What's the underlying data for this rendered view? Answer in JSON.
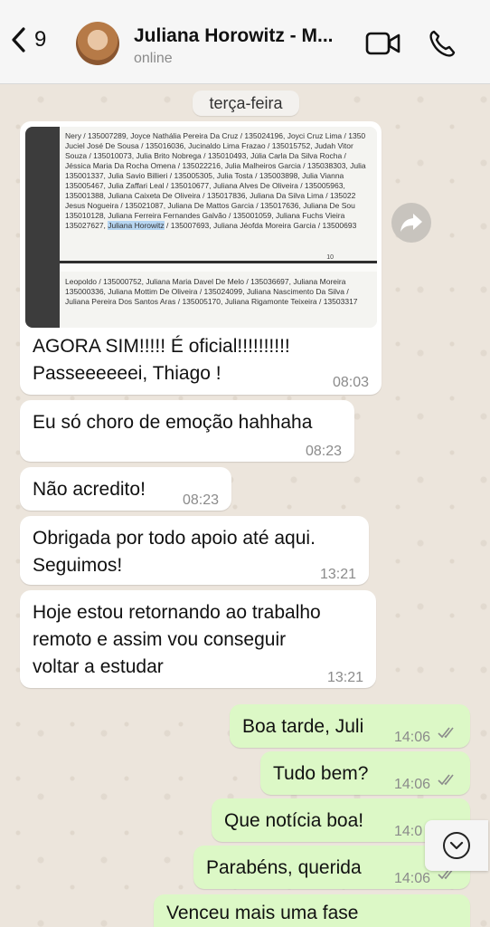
{
  "header": {
    "back_count": "9",
    "contact_name": "Juliana Horowitz - M...",
    "status": "online"
  },
  "date_chip": "terça-feira",
  "photo_lines": [
    "Nery / 135007289, Joyce Nathália Pereira Da Cruz / 135024196, Joyci Cruz Lima / 1350",
    "Juciel José De Sousa / 135016036, Jucinaldo Lima Frazao / 135015752, Judah Vitor",
    "Souza / 135010073, Julia Brito Nobrega / 135010493, Júlia Carla Da Silva Rocha /",
    "Jéssica Maria Da Rocha Omena / 135022216, Julia Malheiros Garcia / 135038303, Julia",
    "135001337, Julia Savio Billieri / 135005305, Julia Tosta / 135003898, Julia Vianna",
    "135005467, Julia Zaffari Leal / 135010677, Juliana Alves De Oliveira / 135005963,",
    "135001388, Juliana Caixeta De Oliveira / 135017836, Juliana Da Silva Lima / 135022",
    "Jesus Nogueira / 135021087, Juliana De Mattos Garcia / 135017636, Juliana De Sou",
    "135010128, Juliana Ferreira Fernandes Galvão / 135001059, Juliana Fuchs Vieira"
  ],
  "photo_highlight_line": {
    "before": "135027627, ",
    "highlight": "Juliana Horowitz",
    "after": " / 135007693, Juliana Jéofda Moreira Garcia / 13500693"
  },
  "photo_page_number": "10",
  "photo_lines_bottom": [
    "Leopoldo / 135000752, Juliana Maria Davel De Melo / 135036697, Juliana Moreira",
    "135000336, Juliana Mottim De Oliveira / 135024099, Juliana Nascimento Da Silva /",
    "Juliana Pereira Dos Santos Aras / 135005170, Juliana Rigamonte Teixeira / 13503317"
  ],
  "messages": [
    {
      "text": "AGORA SIM!!!!! É oficial!!!!!!!!!!\nPasseeeeeei, Thiago !",
      "time": "08:03"
    },
    {
      "text": "Eu só choro de emoção hahhaha",
      "time": "08:23"
    },
    {
      "text": "Não acredito!",
      "time": "08:23"
    },
    {
      "text": "Obrigada por todo apoio até aqui.\nSeguimos!",
      "time": "13:21"
    },
    {
      "text": "Hoje estou retornando ao trabalho\nremoto e assim vou conseguir\nvoltar a estudar",
      "time": "13:21"
    },
    {
      "text": "Boa tarde, Juli",
      "time": "14:06"
    },
    {
      "text": "Tudo bem?",
      "time": "14:06"
    },
    {
      "text": "Que notícia boa!",
      "time": "14:0"
    },
    {
      "text": "Parabéns, querida",
      "time": "14:06"
    },
    {
      "text": "Venceu mais uma fase",
      "time": ""
    }
  ],
  "colors": {
    "incoming_bubble": "#ffffff",
    "outgoing_bubble": "#dcf8c6",
    "read_ticks": "#8b8b8b"
  },
  "icons": {
    "back": "chevron-left-icon",
    "video": "video-camera-icon",
    "call": "phone-icon",
    "forward": "forward-arrow-icon",
    "scroll": "chevron-down-icon",
    "ticks": "double-check-icon"
  }
}
